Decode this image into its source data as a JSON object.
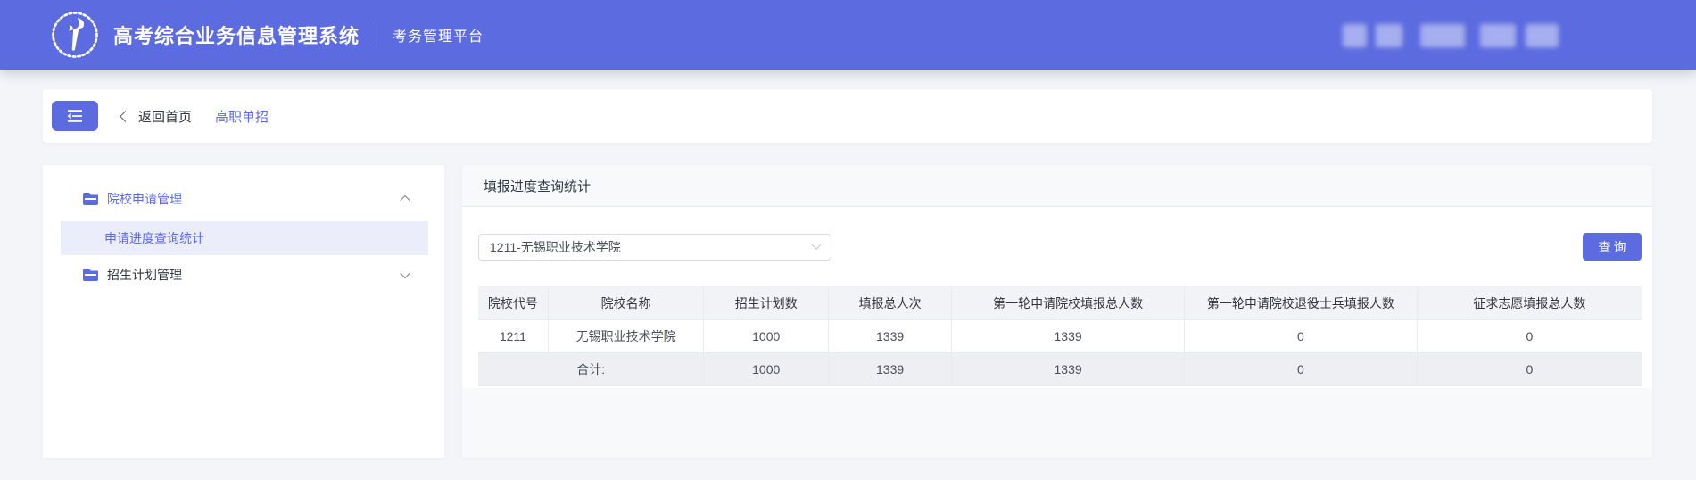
{
  "colors": {
    "accent": "#5c6ce0",
    "active_text": "#5b6be2",
    "selected_menu_bg": "#ebedfb",
    "table_header_bg": "#f2f3f6",
    "total_row_bg": "#edeff2",
    "page_bg": "#f4f5f8"
  },
  "header": {
    "title": "高考综合业务信息管理系统",
    "subtitle": "考务管理平台",
    "logo": "torch-emblem-icon",
    "user_area": "redacted"
  },
  "breadcrumb": {
    "back_label": "返回首页",
    "current": "高职单招"
  },
  "sidebar": {
    "items": [
      {
        "label": "院校申请管理",
        "icon": "folder-icon",
        "expanded": true,
        "active": true,
        "children": [
          {
            "label": "申请进度查询统计",
            "selected": true
          }
        ]
      },
      {
        "label": "招生计划管理",
        "icon": "folder-icon",
        "expanded": false,
        "active": false
      }
    ]
  },
  "main": {
    "title": "填报进度查询统计",
    "school_select": {
      "value": "1211-无锡职业技术学院"
    },
    "query_label": "查询",
    "table": {
      "columns": [
        "院校代号",
        "院校名称",
        "招生计划数",
        "填报总人次",
        "第一轮申请院校填报总人数",
        "第一轮申请院校退役士兵填报人数",
        "征求志愿填报总人数"
      ],
      "rows": [
        [
          "1211",
          "无锡职业技术学院",
          "1000",
          "1339",
          "1339",
          "0",
          "0"
        ]
      ],
      "total": {
        "label": "合计:",
        "values": [
          "1000",
          "1339",
          "1339",
          "0",
          "0"
        ]
      }
    }
  }
}
